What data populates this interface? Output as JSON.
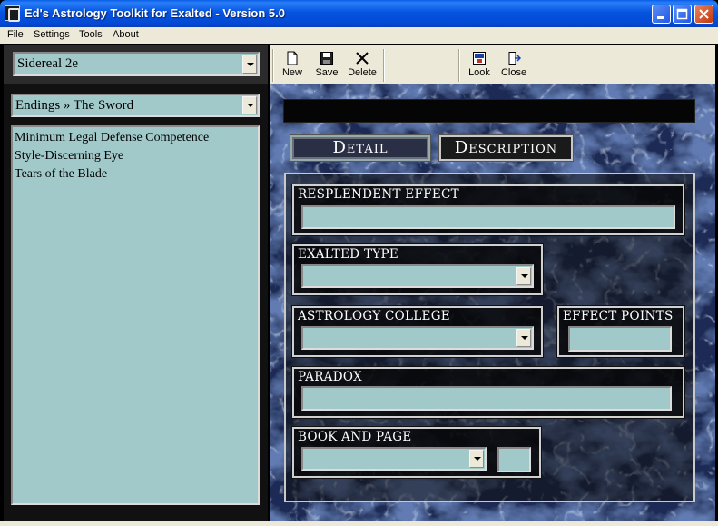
{
  "window": {
    "title": "Ed's Astrology Toolkit for Exalted - Version 5.0"
  },
  "menu": {
    "items": [
      "File",
      "Settings",
      "Tools",
      "About"
    ]
  },
  "left": {
    "edition_select": "Sidereal 2e",
    "category_select": "Endings » The Sword",
    "charms": [
      "Minimum Legal Defense Competence",
      "Style-Discerning Eye",
      "Tears of the Blade"
    ]
  },
  "toolbar": {
    "new_label": "New",
    "save_label": "Save",
    "delete_label": "Delete",
    "look_label": "Look",
    "close_label": "Close",
    "icons": [
      "new-document-icon",
      "floppy-disk-icon",
      "delete-x-icon",
      "look-icon",
      "close-door-icon"
    ]
  },
  "tabs": {
    "detail": "Detail",
    "description": "Description"
  },
  "detail": {
    "resplendent_effect_label": "RESPLENDENT EFFECT",
    "resplendent_effect_value": "",
    "exalted_type_label": "EXALTED TYPE",
    "exalted_type_value": "",
    "astrology_college_label": "ASTROLOGY COLLEGE",
    "astrology_college_value": "",
    "effect_points_label": "EFFECT POINTS",
    "effect_points_value": "",
    "paradox_label": "PARADOX",
    "paradox_value": "",
    "book_and_page_label": "BOOK AND PAGE",
    "book_value": "",
    "page_value": ""
  },
  "colors": {
    "field_teal": "#a1c9c9",
    "titlebar_blue": "#0554e0",
    "chrome_beige": "#ece9d8"
  }
}
